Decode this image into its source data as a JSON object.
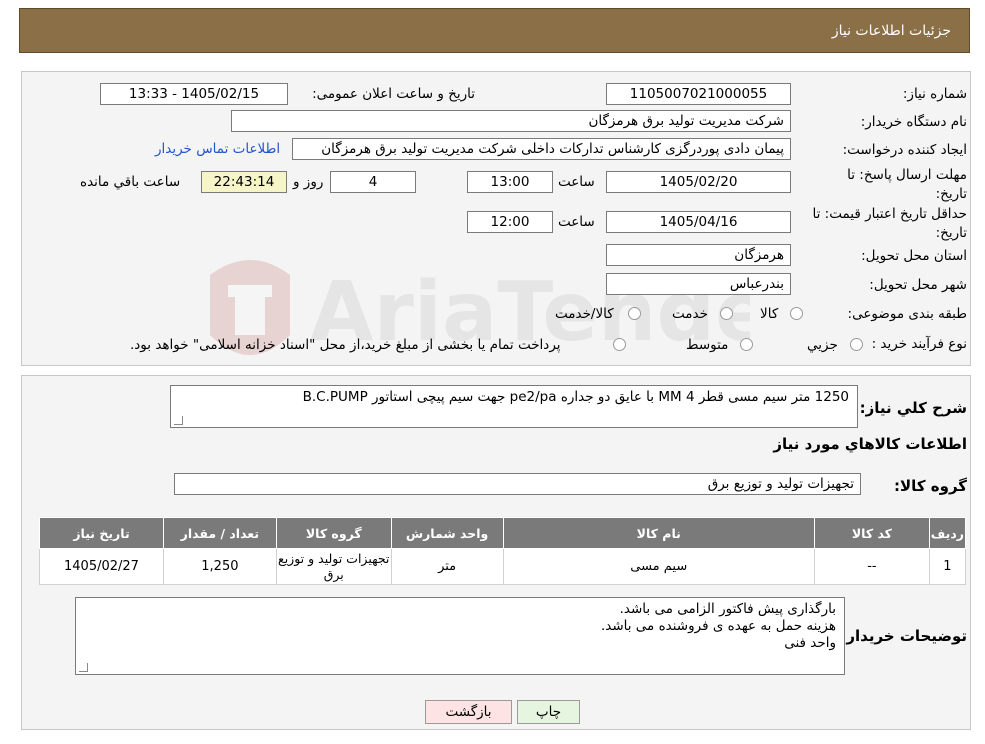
{
  "header": {
    "title": "جزئیات اطلاعات نیاز"
  },
  "labels": {
    "need_number": "شماره نیاز:",
    "announce_datetime": "تاریخ و ساعت اعلان عمومی:",
    "buyer_org": "نام دستگاه خریدار:",
    "requester": "ایجاد کننده درخواست:",
    "reply_deadline": "مهلت ارسال پاسخ: تا تاریخ:",
    "time": "ساعت",
    "day_and": "روز و",
    "remaining": "ساعت باقي مانده",
    "price_validity": "حداقل تاریخ اعتبار قیمت: تا تاریخ:",
    "province": "استان محل تحویل:",
    "city": "شهر محل تحویل:",
    "category": "طبقه بندی موضوعی:",
    "process_type": "نوع فرآیند خرید :",
    "description": "شرح کلي نياز:",
    "goods_info": "اطلاعات کالاهاي مورد نياز",
    "goods_group": "گروه کالا:",
    "buyer_notes": "توضیحات خریدار:"
  },
  "values": {
    "need_number": "1105007021000055",
    "announce_datetime": "1405/02/15 - 13:33",
    "buyer_org": "شرکت مدیریت تولید برق هرمزگان",
    "requester": "پیمان دادی پوردرگزی کارشناس تدارکات داخلی شرکت مدیریت تولید برق هرمزگان",
    "contact_link": "اطلاعات تماس خریدار",
    "reply_date": "1405/02/20",
    "reply_time": "13:00",
    "days": "4",
    "countdown": "22:43:14",
    "validity_date": "1405/04/16",
    "validity_time": "12:00",
    "province": "هرمزگان",
    "city": "بندرعباس",
    "description": "1250 متر سیم مسی قطر 4 MM  با عایق دو جداره pe2/pa جهت سیم پیچی استاتور B.C.PUMP",
    "goods_group": "تجهیزات تولید و توزیع برق"
  },
  "category_options": [
    "کالا",
    "خدمت",
    "کالا/خدمت"
  ],
  "process_options": [
    "جزیي",
    "متوسط"
  ],
  "process_note": "پرداخت تمام یا بخشی از مبلغ خرید،از محل \"اسناد خزانه اسلامی\" خواهد بود.",
  "table": {
    "headers": [
      "ردیف",
      "کد کالا",
      "نام کالا",
      "واحد شمارش",
      "گروه کالا",
      "تعداد / مقدار",
      "تاریخ نیاز"
    ],
    "rows": [
      [
        "1",
        "--",
        "سیم مسی",
        "متر",
        "تجهیزات تولید و توزیع برق",
        "1,250",
        "1405/02/27"
      ]
    ]
  },
  "notes": {
    "line1": "بارگذاری پیش فاکتور الزامی می باشد.",
    "line2": "هزینه حمل به عهده ی فروشنده می باشد.",
    "line3": "واحد فنی"
  },
  "buttons": {
    "print": "چاپ",
    "back": "بازگشت"
  },
  "watermark": {
    "text": "AriaTender.neT"
  },
  "colors": {
    "header": "#8b6f47",
    "table_header": "#7a7a7a",
    "link": "#2255cc",
    "back_button": "#fde3e3",
    "print_button": "#e6f5e0",
    "timer": "#f5f5c8"
  }
}
